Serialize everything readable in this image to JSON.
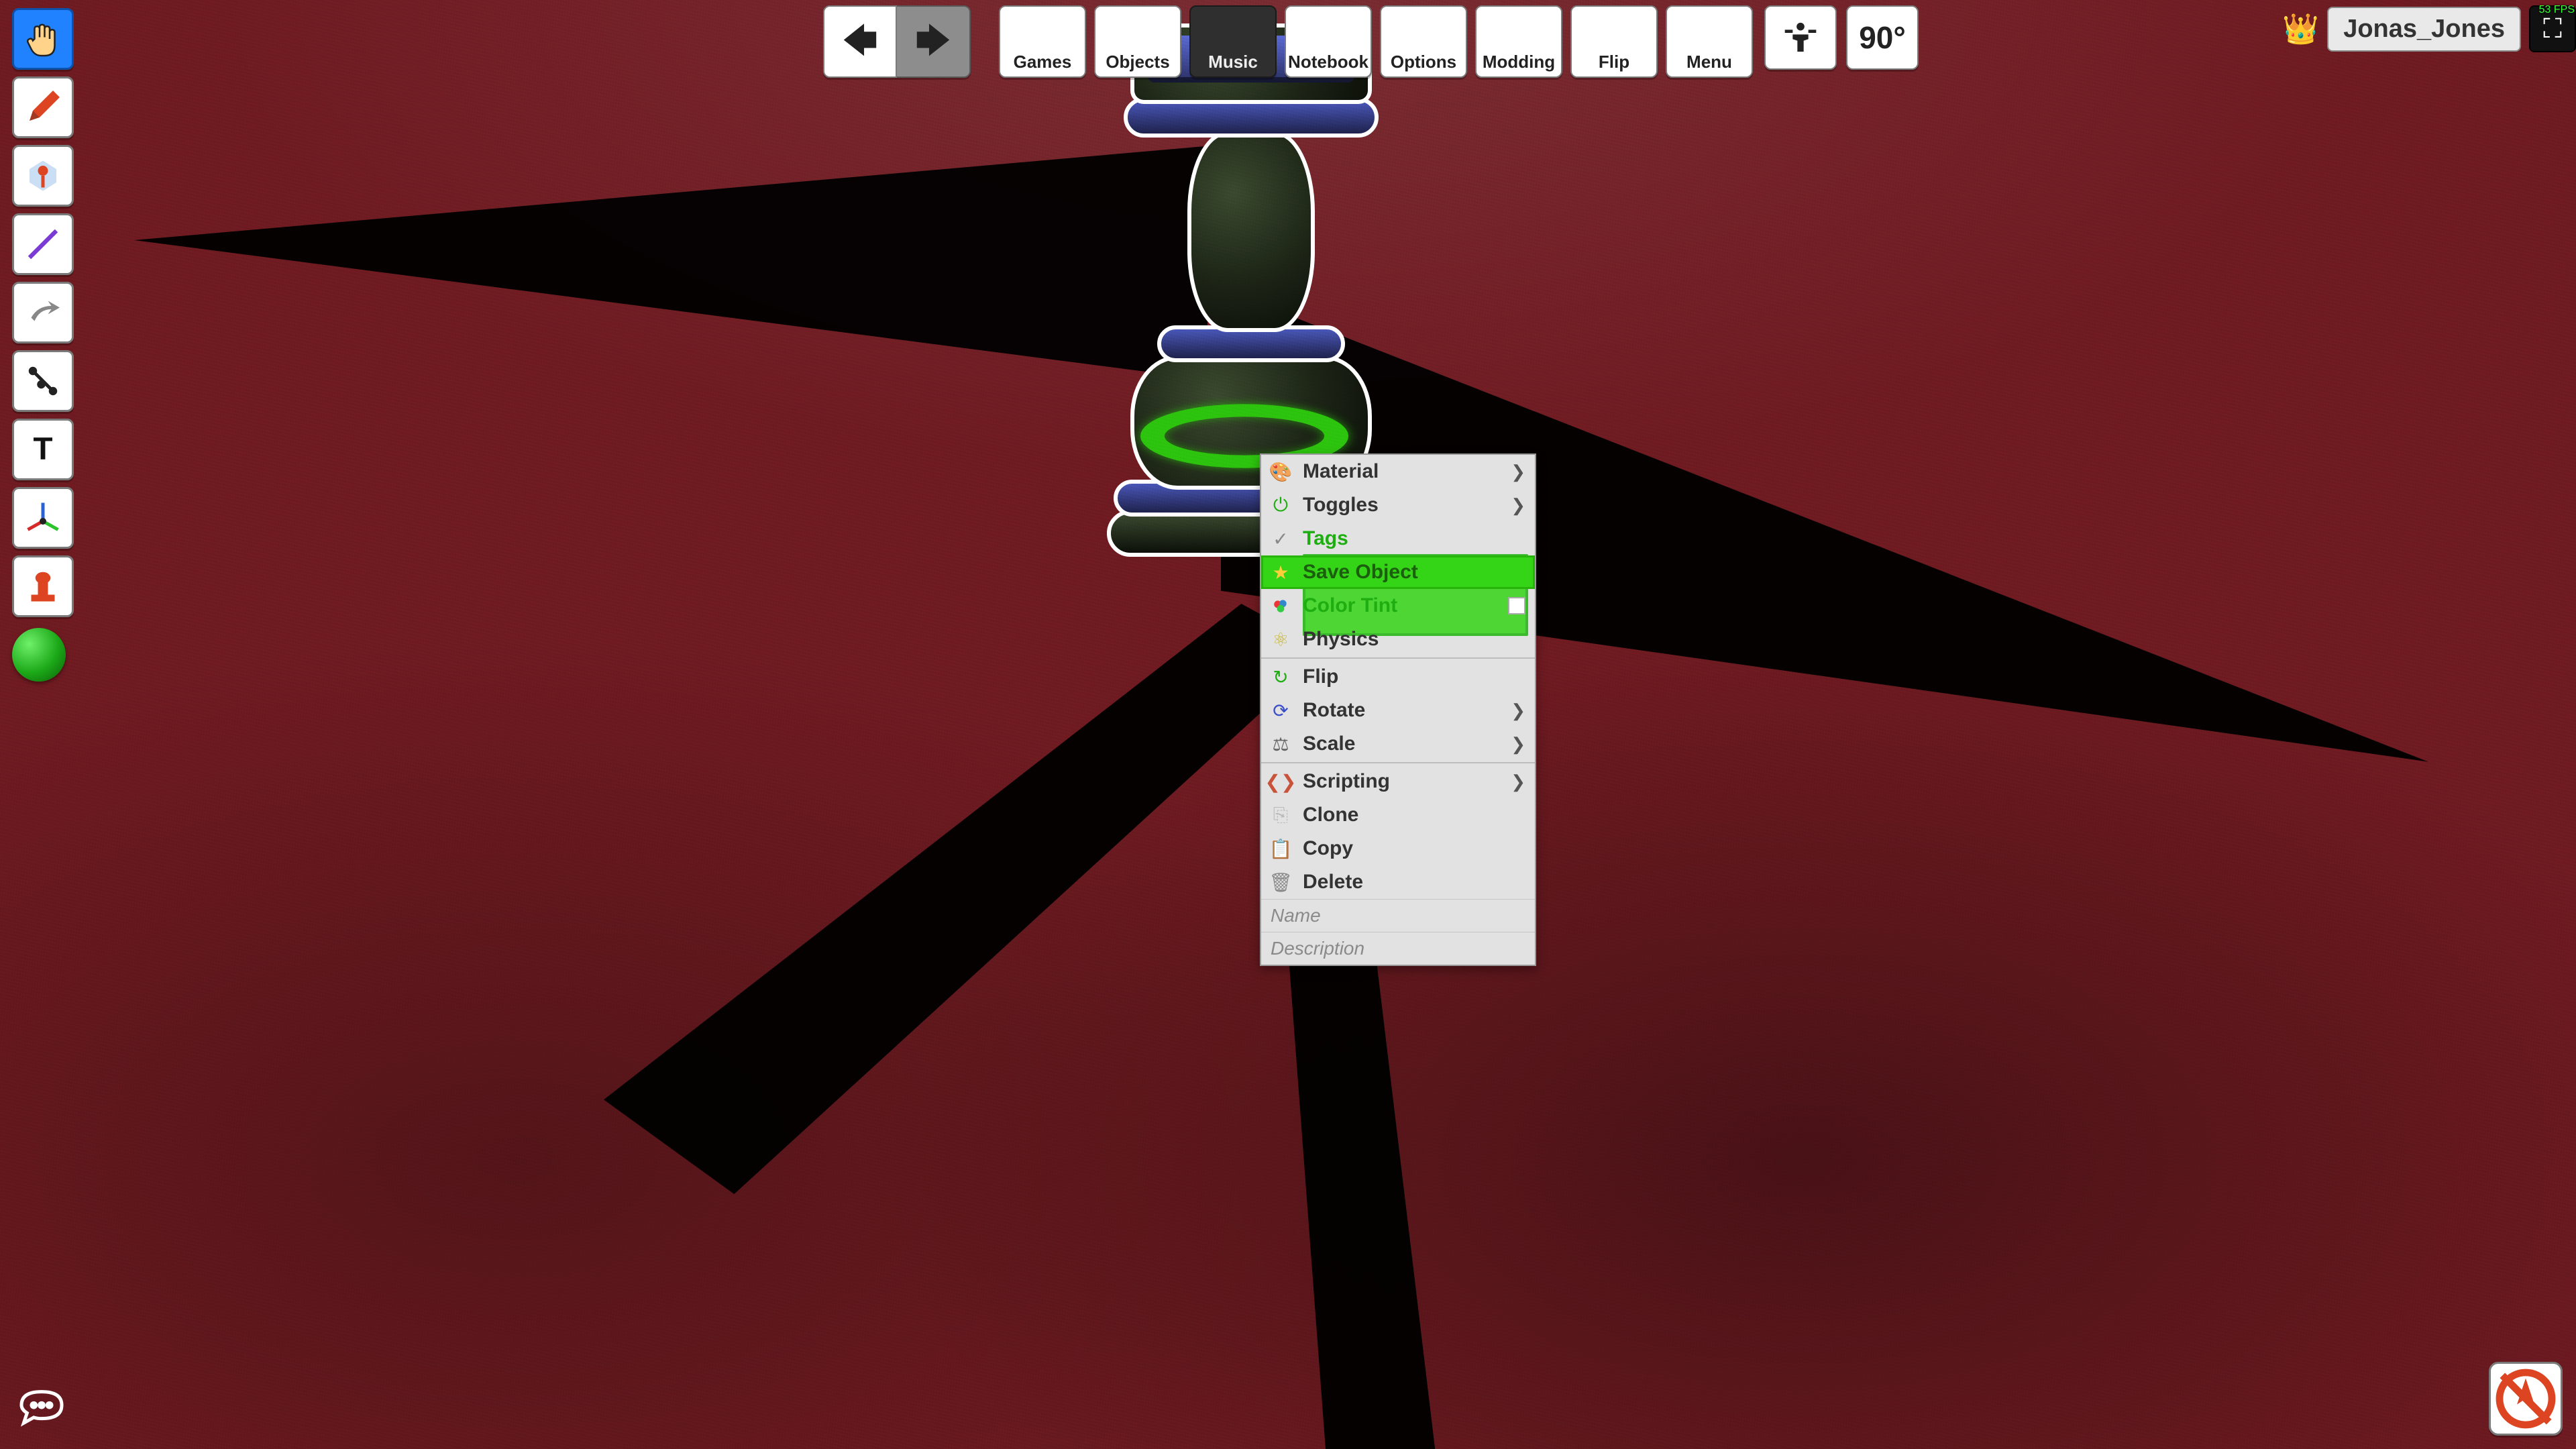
{
  "topbar": {
    "nav_back_icon": "←",
    "nav_fwd_icon": "→",
    "games": {
      "label": "Games",
      "icon": "dice"
    },
    "objects": {
      "label": "Objects",
      "icon": "pawn"
    },
    "music": {
      "label": "Music",
      "icon": "speaker"
    },
    "notebook": {
      "label": "Notebook",
      "icon": "notebook"
    },
    "options": {
      "label": "Options",
      "icon": "sliders"
    },
    "modding": {
      "label": "Modding",
      "icon": "tools"
    },
    "flip": {
      "label": "Flip",
      "icon": "flip"
    },
    "menu": {
      "label": "Menu",
      "icon": "menu"
    }
  },
  "ctx_top": {
    "lift_icon": "lift",
    "degree_label": "90°"
  },
  "user": {
    "name": "Jonas_Jones",
    "fps_label": "53 FPS"
  },
  "left_tools": [
    {
      "id": "hand",
      "active": true
    },
    {
      "id": "pencil",
      "active": false
    },
    {
      "id": "zone",
      "active": false
    },
    {
      "id": "line",
      "active": false
    },
    {
      "id": "flick",
      "active": false
    },
    {
      "id": "joint",
      "active": false
    },
    {
      "id": "text",
      "active": false
    },
    {
      "id": "gizmo",
      "active": false
    },
    {
      "id": "stamp",
      "active": false
    }
  ],
  "color_ball": "green",
  "context_menu": {
    "material": {
      "label": "Material",
      "icon": "palette",
      "submenu": true
    },
    "toggles": {
      "label": "Toggles",
      "icon": "toggle",
      "submenu": true
    },
    "tags": {
      "label": "Tags",
      "icon": "check"
    },
    "save_object": {
      "label": "Save Object",
      "icon": "star"
    },
    "color_tint": {
      "label": "Color Tint",
      "icon": "tint",
      "swatch": "#ffffff"
    },
    "physics": {
      "label": "Physics",
      "icon": "atom"
    },
    "flip": {
      "label": "Flip",
      "icon": "flip"
    },
    "rotate": {
      "label": "Rotate",
      "icon": "rotate",
      "submenu": true
    },
    "scale": {
      "label": "Scale",
      "icon": "scale",
      "submenu": true
    },
    "scripting": {
      "label": "Scripting",
      "icon": "code",
      "submenu": true
    },
    "clone": {
      "label": "Clone",
      "icon": "clone"
    },
    "copy": {
      "label": "Copy",
      "icon": "copy"
    },
    "delete": {
      "label": "Delete",
      "icon": "trash"
    },
    "name_placeholder": "Name",
    "desc_placeholder": "Description"
  }
}
